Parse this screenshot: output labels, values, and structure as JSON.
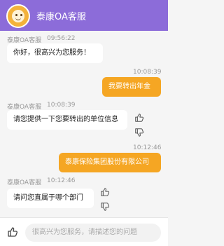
{
  "header": {
    "title": "泰康OA客服"
  },
  "messages": [
    {
      "sender": "泰康OA客服",
      "time": "09:56:22",
      "text": "你好，很高兴为您服务！"
    },
    {
      "time": "10:08:39",
      "text": "我要转出年金"
    },
    {
      "sender": "泰康OA客服",
      "time": "10:08:39",
      "text": "请您提供一下您要转出的单位信息"
    },
    {
      "time": "10:12:46",
      "text": "泰康保险集团股份有限公司"
    },
    {
      "sender": "泰康OA客服",
      "time": "10:12:46",
      "text": "请问您直属于哪个部门"
    }
  ],
  "footer": {
    "placeholder": "很高兴为您服务，请描述您的问题"
  },
  "colors": {
    "header": "#8c6cd9",
    "user_bubble": "#f5a623"
  },
  "icons": [
    "avatar-icon",
    "thumbs-up-icon",
    "thumbs-down-icon",
    "feedback-thumb-icon"
  ]
}
